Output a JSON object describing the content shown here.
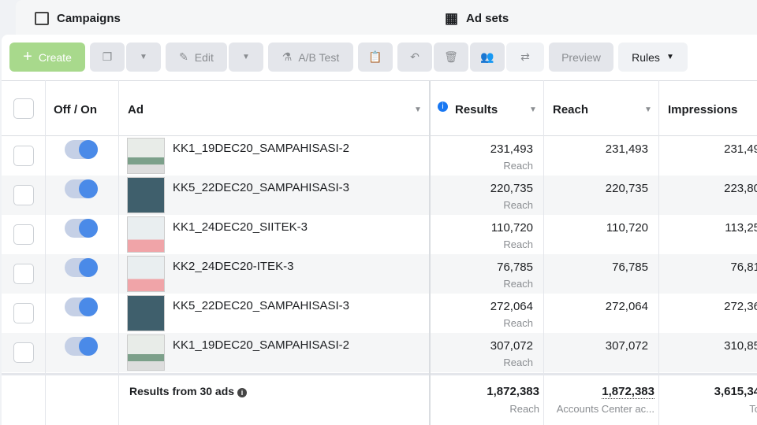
{
  "tabs": [
    {
      "label": "Campaigns",
      "icon": "folder-icon"
    },
    {
      "label": "Ad sets",
      "icon": "grid-icon"
    }
  ],
  "toolbar": {
    "create": "Create",
    "edit": "Edit",
    "ab_test": "A/B Test",
    "preview": "Preview",
    "rules": "Rules"
  },
  "colors": {
    "create": "#a8d98c",
    "toggle": "#4a8ae8",
    "info": "#1877f2"
  },
  "columns": {
    "toggle": "Off / On",
    "ad": "Ad",
    "results": "Results",
    "reach": "Reach",
    "impressions": "Impressions"
  },
  "rows": [
    {
      "name": "KK1_19DEC20_SAMPAHISASI-2",
      "results": "231,493",
      "results_sub": "Reach",
      "reach": "231,493",
      "impressions": "231,49",
      "on": true
    },
    {
      "name": "KK5_22DEC20_SAMPAHISASI-3",
      "results": "220,735",
      "results_sub": "Reach",
      "reach": "220,735",
      "impressions": "223,80",
      "on": true
    },
    {
      "name": "KK1_24DEC20_SIITEK-3",
      "results": "110,720",
      "results_sub": "Reach",
      "reach": "110,720",
      "impressions": "113,25",
      "on": true
    },
    {
      "name": "KK2_24DEC20-ITEK-3",
      "results": "76,785",
      "results_sub": "Reach",
      "reach": "76,785",
      "impressions": "76,81",
      "on": true
    },
    {
      "name": "KK5_22DEC20_SAMPAHISASI-3",
      "results": "272,064",
      "results_sub": "Reach",
      "reach": "272,064",
      "impressions": "272,36",
      "on": true
    },
    {
      "name": "KK1_19DEC20_SAMPAHISASI-2",
      "results": "307,072",
      "results_sub": "Reach",
      "reach": "307,072",
      "impressions": "310,85",
      "on": true
    }
  ],
  "footer": {
    "label": "Results from 30 ads",
    "results": "1,872,383",
    "results_sub": "Reach",
    "reach": "1,872,383",
    "reach_sub": "Accounts Center ac...",
    "impressions": "3,615,34",
    "impressions_sub": "To"
  }
}
